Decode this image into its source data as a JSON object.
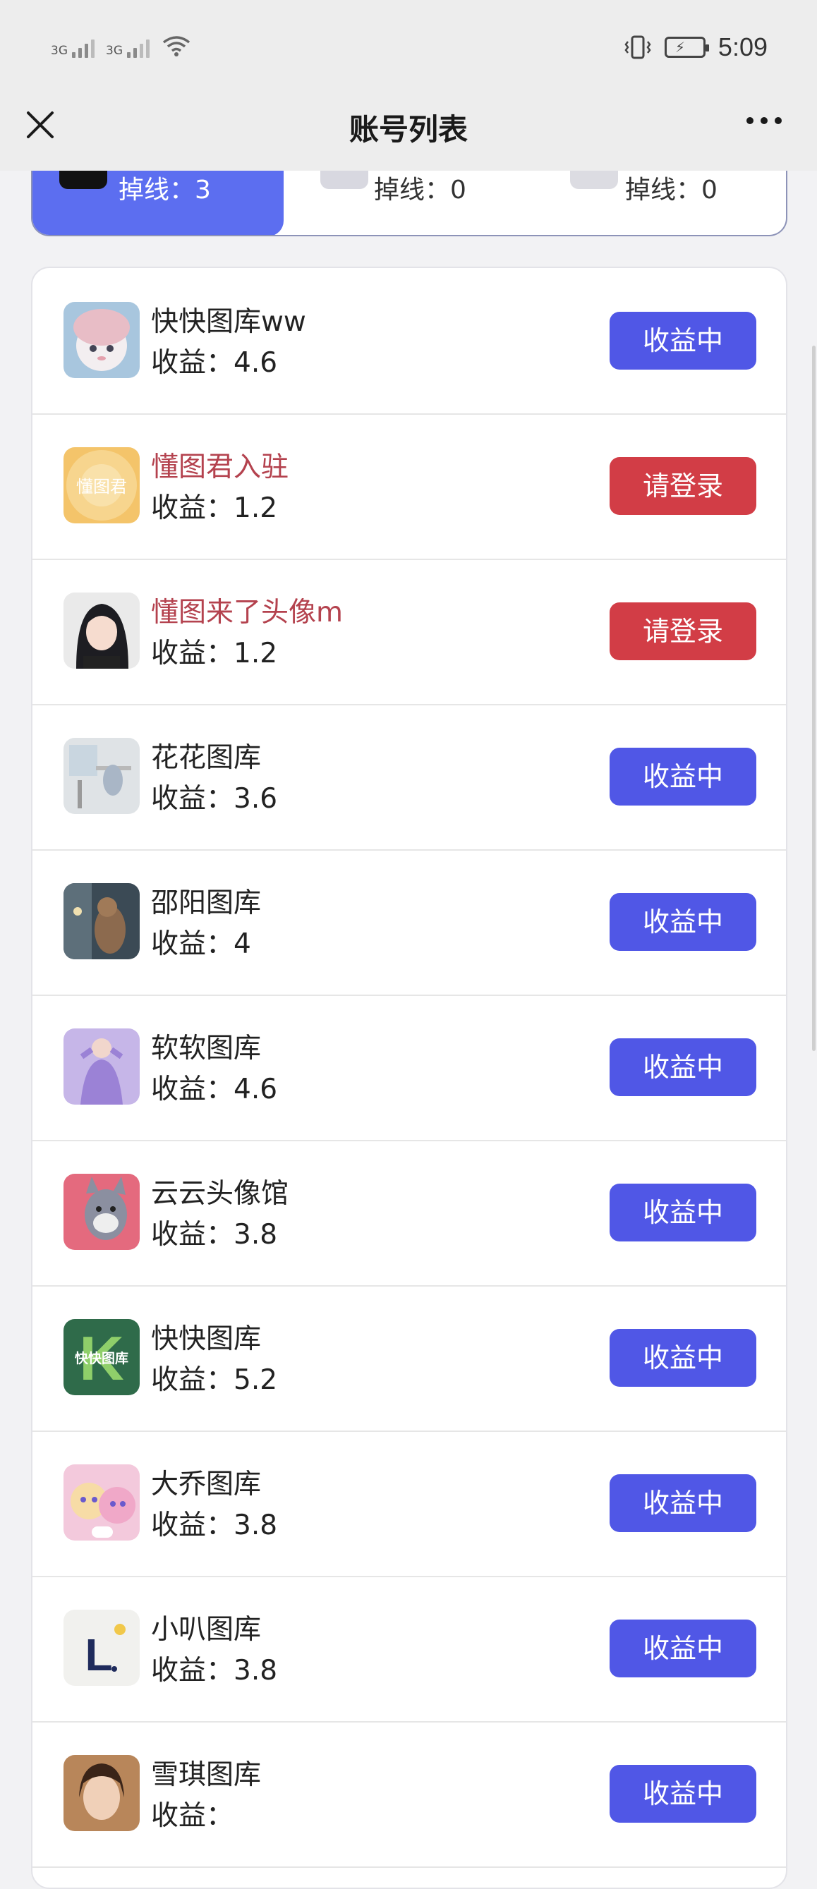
{
  "status_bar": {
    "sim1_label": "3G",
    "sim2_label": "3G",
    "time": "5:09",
    "icons": [
      "signal-icon",
      "wifi-icon",
      "vibrate-icon",
      "battery-charging-icon"
    ]
  },
  "nav": {
    "title": "账号列表",
    "close_icon": "close-icon",
    "more_icon": "more-icon"
  },
  "platform_tabs": [
    {
      "offline_text": "掉线：3",
      "active": true
    },
    {
      "offline_text": "掉线：0",
      "active": false
    },
    {
      "offline_text": "掉线：0",
      "active": false
    }
  ],
  "colors": {
    "accent": "#5c6ef0",
    "earning_button": "#5057e6",
    "login_button": "#d23d46",
    "warning_name": "#b4424e"
  },
  "accounts": [
    {
      "name": "快快图库ww",
      "income": "收益：4.6",
      "button": "收益中",
      "status": "earning"
    },
    {
      "name": "懂图君入驻",
      "income": "收益：1.2",
      "button": "请登录",
      "status": "login"
    },
    {
      "name": "懂图来了头像m",
      "income": "收益：1.2",
      "button": "请登录",
      "status": "login"
    },
    {
      "name": "花花图库",
      "income": "收益：3.6",
      "button": "收益中",
      "status": "earning"
    },
    {
      "name": "邵阳图库",
      "income": "收益：4",
      "button": "收益中",
      "status": "earning"
    },
    {
      "name": "软软图库",
      "income": "收益：4.6",
      "button": "收益中",
      "status": "earning"
    },
    {
      "name": "云云头像馆",
      "income": "收益：3.8",
      "button": "收益中",
      "status": "earning"
    },
    {
      "name": "快快图库",
      "income": "收益：5.2",
      "button": "收益中",
      "status": "earning"
    },
    {
      "name": "大乔图库",
      "income": "收益：3.8",
      "button": "收益中",
      "status": "earning"
    },
    {
      "name": "小叭图库",
      "income": "收益：3.8",
      "button": "收益中",
      "status": "earning"
    },
    {
      "name": "雪琪图库",
      "income": "收益：",
      "button": "收益中",
      "status": "earning"
    }
  ],
  "avatar_texts": {
    "dongtu": "懂图君",
    "kuaikuai": "快快图库",
    "xiaoba": "L"
  }
}
